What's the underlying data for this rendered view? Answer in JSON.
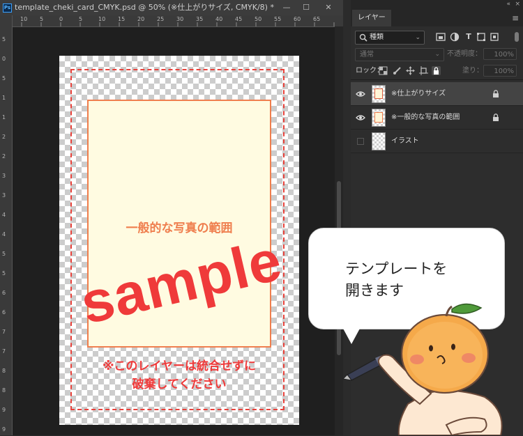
{
  "document": {
    "title": "template_cheki_card_CMYK.psd @ 50% (※仕上がりサイズ, CMYK/8) *",
    "app_badge": "Ps",
    "window_controls": {
      "minimize": "—",
      "maximize": "☐",
      "close": "✕"
    },
    "ruler_top_labels": [
      "10",
      "5",
      "0",
      "5",
      "10",
      "15",
      "20",
      "25",
      "30",
      "35",
      "40",
      "45",
      "50",
      "55",
      "60",
      "65"
    ],
    "ruler_left_labels": [
      "5",
      "0",
      "5",
      "1",
      "1",
      "2",
      "2",
      "3",
      "3",
      "4",
      "4",
      "5",
      "5",
      "6",
      "6",
      "7",
      "7",
      "8",
      "8",
      "9",
      "9"
    ]
  },
  "canvas": {
    "photo_area_label": "一般的な写真の範囲",
    "sample_watermark": "sample",
    "notice_line1": "※このレイヤーは統合せずに",
    "notice_line2": "破棄してください"
  },
  "panel": {
    "collapse_glyph": "«",
    "close_glyph": "×",
    "tab_label": "レイヤー",
    "menu_glyph": "≡",
    "filter": {
      "label": "種類",
      "icon": "search-icon",
      "chevron": "⌄"
    },
    "filter_icons": [
      "image-filter-icon",
      "adjustment-filter-icon",
      "type-filter-icon",
      "shape-filter-icon",
      "smart-object-filter-icon"
    ],
    "blend_mode": "通常",
    "opacity_label": "不透明度：",
    "opacity_value": "100%",
    "lock_label": "ロック：",
    "fill_label": "塗り：",
    "fill_value": "100%",
    "layers": [
      {
        "name": "※仕上がりサイズ",
        "visible": true,
        "locked": true,
        "selected": true
      },
      {
        "name": "※一般的な写真の範囲",
        "visible": true,
        "locked": true,
        "selected": false
      },
      {
        "name": "イラスト",
        "visible": false,
        "locked": false,
        "selected": false
      }
    ]
  },
  "bubble": {
    "line1": "テンプレートを",
    "line2": "開きます"
  },
  "colors": {
    "accent_red": "#ef3a3a",
    "photo_border_orange": "#ef7e4e",
    "photo_fill_cream": "#fffbe1",
    "panel_bg": "#2d2d2d"
  }
}
